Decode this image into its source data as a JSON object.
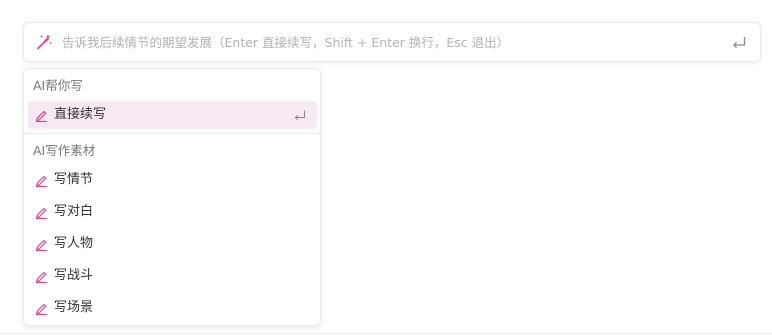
{
  "prompt": {
    "placeholder": "告诉我后续情节的期望发展（Enter 直接续写，Shift + Enter 换行，Esc 退出）",
    "value": ""
  },
  "menu": {
    "ai_help_title": "AI帮你写",
    "continue_item": "直接续写",
    "materials_title": "AI写作素材",
    "items": [
      {
        "label": "写情节"
      },
      {
        "label": "写对白"
      },
      {
        "label": "写人物"
      },
      {
        "label": "写战斗"
      },
      {
        "label": "写场景"
      }
    ]
  },
  "colors": {
    "accent": "#e0408f",
    "highlight_bg": "#f7e9f3",
    "placeholder": "#b3b3b3"
  },
  "icons": {
    "prompt_left": "magic-wand-icon",
    "prompt_right": "enter-key-icon",
    "menu_item": "pencil-icon"
  }
}
